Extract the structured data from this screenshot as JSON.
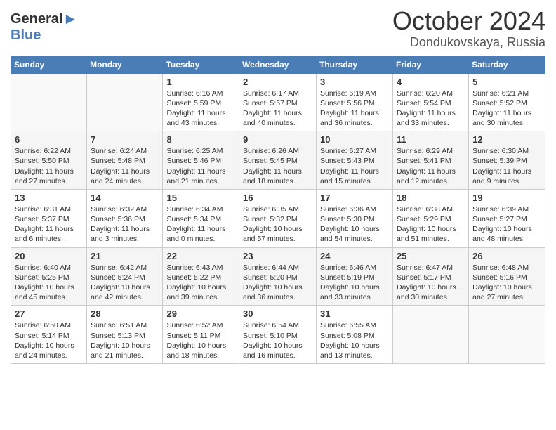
{
  "header": {
    "logo_general": "General",
    "logo_blue": "Blue",
    "title": "October 2024",
    "subtitle": "Dondukovskaya, Russia"
  },
  "days_of_week": [
    "Sunday",
    "Monday",
    "Tuesday",
    "Wednesday",
    "Thursday",
    "Friday",
    "Saturday"
  ],
  "weeks": [
    [
      {
        "day": "",
        "info": ""
      },
      {
        "day": "",
        "info": ""
      },
      {
        "day": "1",
        "info": "Sunrise: 6:16 AM\nSunset: 5:59 PM\nDaylight: 11 hours and 43 minutes."
      },
      {
        "day": "2",
        "info": "Sunrise: 6:17 AM\nSunset: 5:57 PM\nDaylight: 11 hours and 40 minutes."
      },
      {
        "day": "3",
        "info": "Sunrise: 6:19 AM\nSunset: 5:56 PM\nDaylight: 11 hours and 36 minutes."
      },
      {
        "day": "4",
        "info": "Sunrise: 6:20 AM\nSunset: 5:54 PM\nDaylight: 11 hours and 33 minutes."
      },
      {
        "day": "5",
        "info": "Sunrise: 6:21 AM\nSunset: 5:52 PM\nDaylight: 11 hours and 30 minutes."
      }
    ],
    [
      {
        "day": "6",
        "info": "Sunrise: 6:22 AM\nSunset: 5:50 PM\nDaylight: 11 hours and 27 minutes."
      },
      {
        "day": "7",
        "info": "Sunrise: 6:24 AM\nSunset: 5:48 PM\nDaylight: 11 hours and 24 minutes."
      },
      {
        "day": "8",
        "info": "Sunrise: 6:25 AM\nSunset: 5:46 PM\nDaylight: 11 hours and 21 minutes."
      },
      {
        "day": "9",
        "info": "Sunrise: 6:26 AM\nSunset: 5:45 PM\nDaylight: 11 hours and 18 minutes."
      },
      {
        "day": "10",
        "info": "Sunrise: 6:27 AM\nSunset: 5:43 PM\nDaylight: 11 hours and 15 minutes."
      },
      {
        "day": "11",
        "info": "Sunrise: 6:29 AM\nSunset: 5:41 PM\nDaylight: 11 hours and 12 minutes."
      },
      {
        "day": "12",
        "info": "Sunrise: 6:30 AM\nSunset: 5:39 PM\nDaylight: 11 hours and 9 minutes."
      }
    ],
    [
      {
        "day": "13",
        "info": "Sunrise: 6:31 AM\nSunset: 5:37 PM\nDaylight: 11 hours and 6 minutes."
      },
      {
        "day": "14",
        "info": "Sunrise: 6:32 AM\nSunset: 5:36 PM\nDaylight: 11 hours and 3 minutes."
      },
      {
        "day": "15",
        "info": "Sunrise: 6:34 AM\nSunset: 5:34 PM\nDaylight: 11 hours and 0 minutes."
      },
      {
        "day": "16",
        "info": "Sunrise: 6:35 AM\nSunset: 5:32 PM\nDaylight: 10 hours and 57 minutes."
      },
      {
        "day": "17",
        "info": "Sunrise: 6:36 AM\nSunset: 5:30 PM\nDaylight: 10 hours and 54 minutes."
      },
      {
        "day": "18",
        "info": "Sunrise: 6:38 AM\nSunset: 5:29 PM\nDaylight: 10 hours and 51 minutes."
      },
      {
        "day": "19",
        "info": "Sunrise: 6:39 AM\nSunset: 5:27 PM\nDaylight: 10 hours and 48 minutes."
      }
    ],
    [
      {
        "day": "20",
        "info": "Sunrise: 6:40 AM\nSunset: 5:25 PM\nDaylight: 10 hours and 45 minutes."
      },
      {
        "day": "21",
        "info": "Sunrise: 6:42 AM\nSunset: 5:24 PM\nDaylight: 10 hours and 42 minutes."
      },
      {
        "day": "22",
        "info": "Sunrise: 6:43 AM\nSunset: 5:22 PM\nDaylight: 10 hours and 39 minutes."
      },
      {
        "day": "23",
        "info": "Sunrise: 6:44 AM\nSunset: 5:20 PM\nDaylight: 10 hours and 36 minutes."
      },
      {
        "day": "24",
        "info": "Sunrise: 6:46 AM\nSunset: 5:19 PM\nDaylight: 10 hours and 33 minutes."
      },
      {
        "day": "25",
        "info": "Sunrise: 6:47 AM\nSunset: 5:17 PM\nDaylight: 10 hours and 30 minutes."
      },
      {
        "day": "26",
        "info": "Sunrise: 6:48 AM\nSunset: 5:16 PM\nDaylight: 10 hours and 27 minutes."
      }
    ],
    [
      {
        "day": "27",
        "info": "Sunrise: 6:50 AM\nSunset: 5:14 PM\nDaylight: 10 hours and 24 minutes."
      },
      {
        "day": "28",
        "info": "Sunrise: 6:51 AM\nSunset: 5:13 PM\nDaylight: 10 hours and 21 minutes."
      },
      {
        "day": "29",
        "info": "Sunrise: 6:52 AM\nSunset: 5:11 PM\nDaylight: 10 hours and 18 minutes."
      },
      {
        "day": "30",
        "info": "Sunrise: 6:54 AM\nSunset: 5:10 PM\nDaylight: 10 hours and 16 minutes."
      },
      {
        "day": "31",
        "info": "Sunrise: 6:55 AM\nSunset: 5:08 PM\nDaylight: 10 hours and 13 minutes."
      },
      {
        "day": "",
        "info": ""
      },
      {
        "day": "",
        "info": ""
      }
    ]
  ]
}
